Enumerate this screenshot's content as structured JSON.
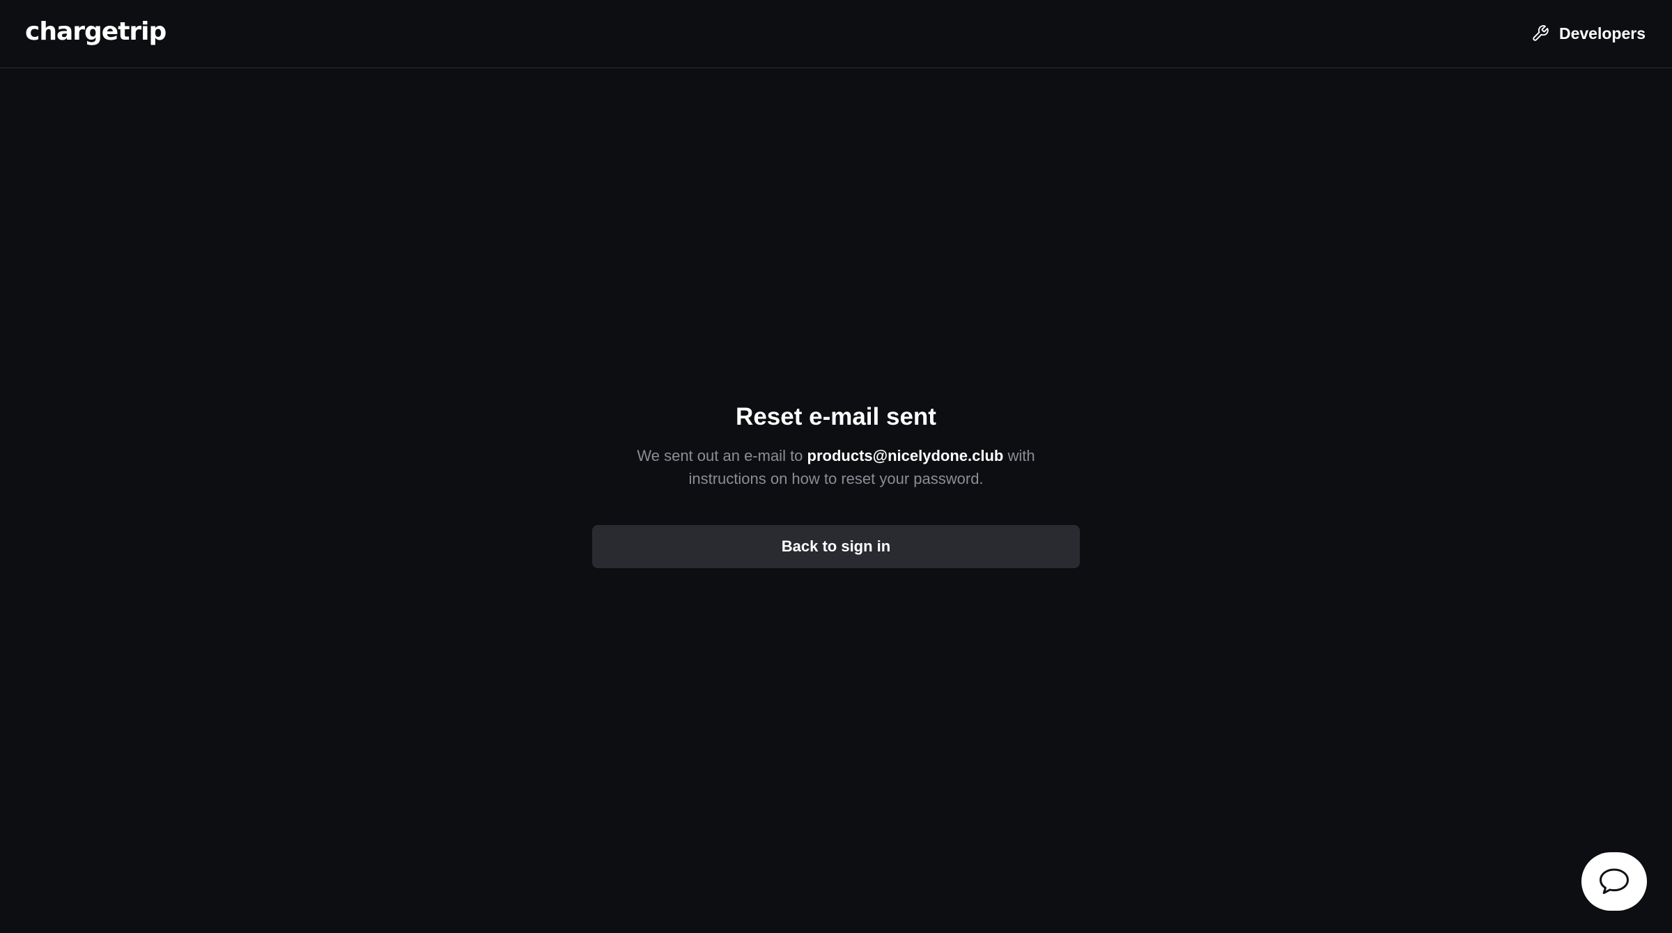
{
  "header": {
    "logo_text": "chargetrip",
    "developers_label": "Developers",
    "developers_icon": "wrench-icon"
  },
  "main": {
    "title": "Reset e-mail sent",
    "desc_prefix": "We sent out an e-mail to ",
    "email": "products@nicelydone.club",
    "desc_suffix": " with instructions on how to reset your password.",
    "back_button_label": "Back to sign in"
  },
  "chat": {
    "icon": "chat-bubble-icon"
  },
  "colors": {
    "background": "#0d0e11",
    "button_bg": "#2a2b31",
    "muted_text": "#8a8d96",
    "text": "#ffffff"
  }
}
